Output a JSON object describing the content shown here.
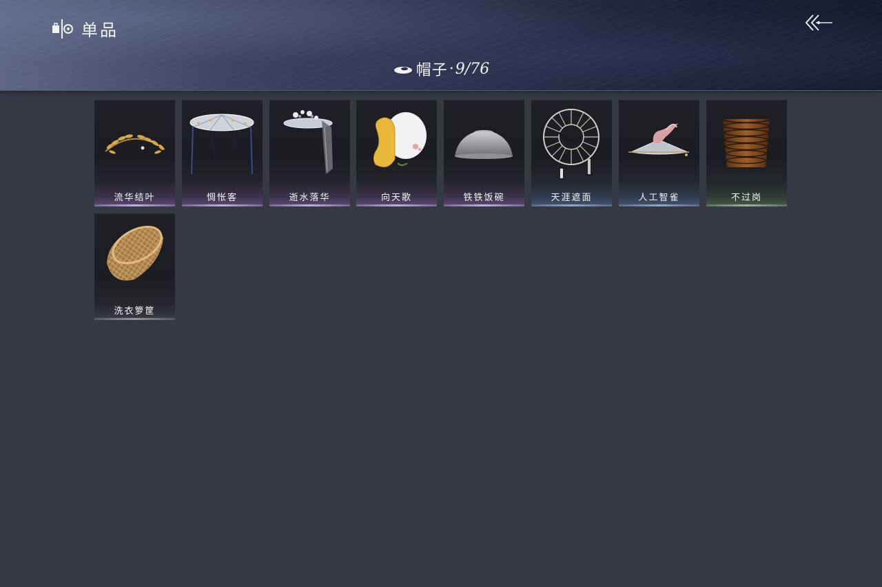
{
  "header": {
    "title": "单品",
    "brand_icon": "wardrobe-logo-icon",
    "back_icon": "chevron-double-left-icon"
  },
  "category": {
    "icon": "hat-icon",
    "label": "帽子",
    "separator": "·",
    "count": "9/76"
  },
  "items": [
    {
      "name": "流华结叶",
      "icon": "laurel-crown-icon",
      "rarity_color": "#5b4a74"
    },
    {
      "name": "惆怅客",
      "icon": "veiled-bamboo-hat-icon",
      "rarity_color": "#5b4a74"
    },
    {
      "name": "逝水落华",
      "icon": "flower-veil-hat-icon",
      "rarity_color": "#5b4a74"
    },
    {
      "name": "向天歌",
      "icon": "duck-hat-icon",
      "rarity_color": "#5b4a74"
    },
    {
      "name": "铁铁饭碗",
      "icon": "iron-bowl-hat-icon",
      "rarity_color": "#5b4a74"
    },
    {
      "name": "天涯遮面",
      "icon": "ribbed-hat-icon",
      "rarity_color": "#44556f"
    },
    {
      "name": "人工智雀",
      "icon": "bird-hat-icon",
      "rarity_color": "#44556f"
    },
    {
      "name": "不过岗",
      "icon": "stacked-bowls-hat-icon",
      "rarity_color": "#465a4a"
    },
    {
      "name": "洗衣箩筐",
      "icon": "wicker-basket-hat-icon",
      "rarity_color": "#3a3d45"
    }
  ]
}
